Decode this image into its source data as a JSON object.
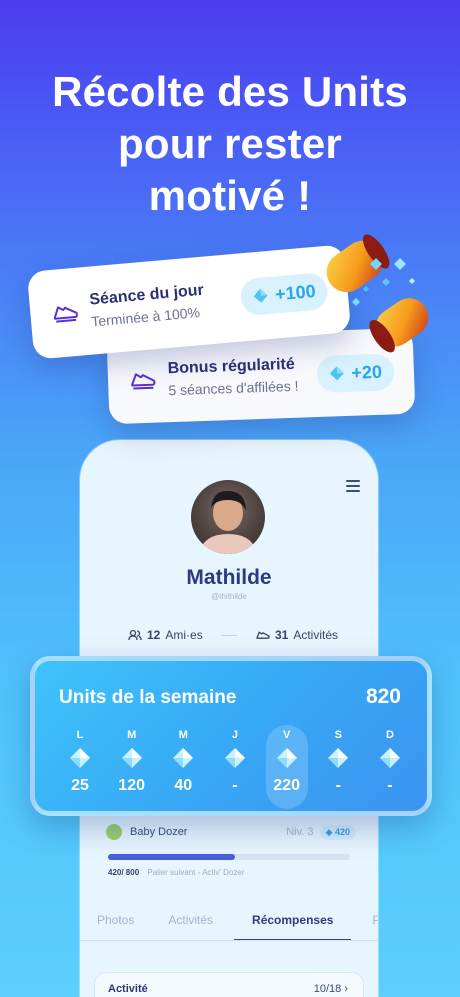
{
  "headline": [
    "Récolte des Units",
    "pour rester",
    "motivé !"
  ],
  "reward_cards": [
    {
      "title": "Séance du jour",
      "subtitle": "Terminée à 100%",
      "amount": "+100",
      "icon": "shoe-icon"
    },
    {
      "title": "Bonus régularité",
      "subtitle": "5 séances d'affilées !",
      "amount": "+20",
      "icon": "shoe-icon"
    }
  ],
  "profile": {
    "name": "Mathilde",
    "handle": "@thithilde",
    "friends_count": "12",
    "friends_label": "Ami·es",
    "activities_count": "31",
    "activities_label": "Activités"
  },
  "units_week": {
    "title": "Units de la semaine",
    "total": "820",
    "days": [
      {
        "letter": "L",
        "value": "25"
      },
      {
        "letter": "M",
        "value": "120"
      },
      {
        "letter": "M",
        "value": "40"
      },
      {
        "letter": "J",
        "value": "-"
      },
      {
        "letter": "V",
        "value": "220",
        "highlighted": true
      },
      {
        "letter": "S",
        "value": "-"
      },
      {
        "letter": "D",
        "value": "-"
      }
    ]
  },
  "level": {
    "name": "Baby Dozer",
    "level_label": "Niv. 3",
    "units": "420",
    "progress_text": "420/ 800",
    "next_label": "Palier suivant - Activ' Dozer",
    "progress_fraction": 0.525
  },
  "tabs": [
    "Photos",
    "Activités",
    "Récompenses",
    "Pl"
  ],
  "activity": {
    "label": "Activité",
    "count": "10/18"
  },
  "colors": {
    "accent": "#3fc3fa",
    "brand": "#2c3a83",
    "gem": "#27a6e8"
  }
}
